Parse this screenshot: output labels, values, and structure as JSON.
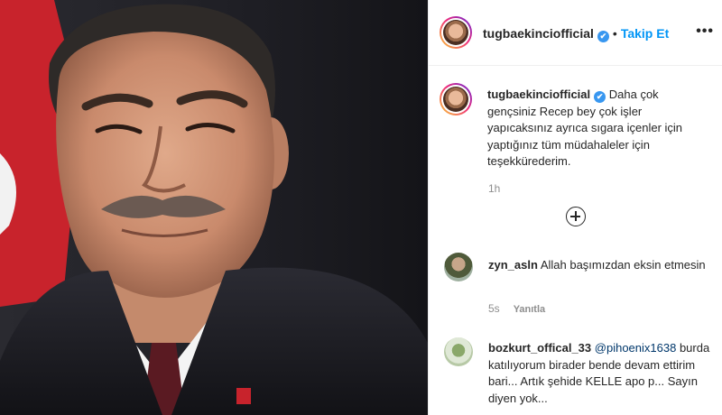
{
  "post": {
    "username": "tugbaekinciofficial",
    "verified_mark": "✔",
    "separator": "•",
    "follow_label": "Takip Et",
    "more_label": "•••"
  },
  "caption": {
    "username": "tugbaekinciofficial",
    "verified_mark": "✔",
    "text": "Daha çok gençsiniz Recep bey çok işler yapıcaksınız ayrıca sıgara içenler için yaptığınız tüm müdahaleler için teşekkürederim.",
    "time": "1h"
  },
  "load_more_icon": "plus-circle-icon",
  "comments": [
    {
      "username": "zyn_asln",
      "text": "Allah başımızdan eksin etmesin",
      "time": "5s",
      "reply_label": "Yanıtla"
    },
    {
      "username": "bozkurt_offical_33",
      "mention": "@pihoenix1638",
      "text": "burda katılıyorum birader bende devam ettirim bari... Artık şehide KELLE apo p... Sayın diyen yok..."
    }
  ],
  "colors": {
    "accent": "#0095f6",
    "verified": "#3897f0",
    "muted": "#8e8e8e",
    "text": "#262626"
  }
}
